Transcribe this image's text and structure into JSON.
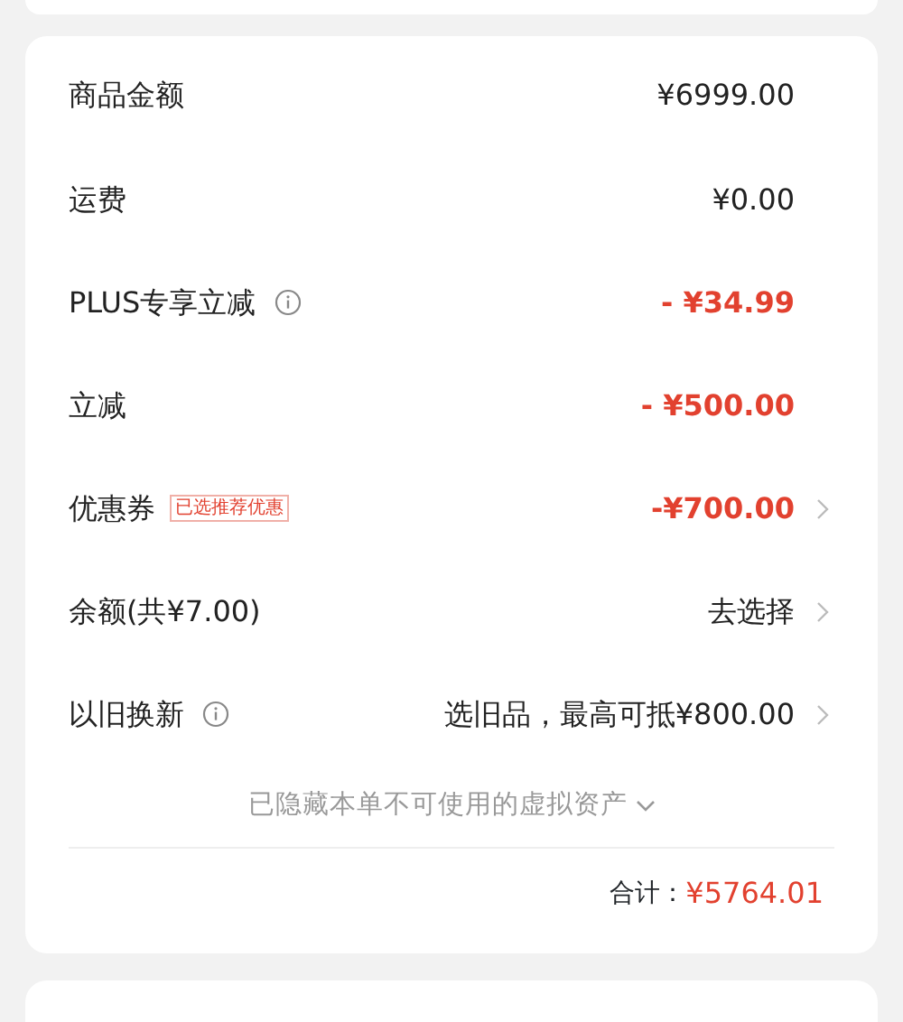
{
  "rows": [
    {
      "label": "商品金额",
      "info": false,
      "value": "¥6999.00",
      "kind": "amount",
      "chevron": false
    },
    {
      "label": "运费",
      "info": false,
      "value": "¥0.00",
      "kind": "amount",
      "chevron": false
    },
    {
      "label": "PLUS专享立减",
      "info": true,
      "value": "- ¥34.99",
      "kind": "discount",
      "chevron": false
    },
    {
      "label": "立减",
      "info": false,
      "value": "- ¥500.00",
      "kind": "discount",
      "chevron": false
    },
    {
      "label": "优惠券",
      "info": false,
      "tag": "已选推荐优惠",
      "value": "-¥700.00",
      "kind": "discount",
      "chevron": true
    },
    {
      "label": "余额(共¥7.00)",
      "info": false,
      "value": "去选择",
      "kind": "amount",
      "chevron": true
    },
    {
      "label": "以旧换新",
      "info": true,
      "value": "选旧品，最高可抵¥800.00",
      "kind": "amount",
      "chevron": true
    }
  ],
  "hidden_assets": {
    "text": "已隐藏本单不可使用的虚拟资产",
    "expanded": false
  },
  "total": {
    "label": "合计：",
    "value": "¥5764.01"
  }
}
